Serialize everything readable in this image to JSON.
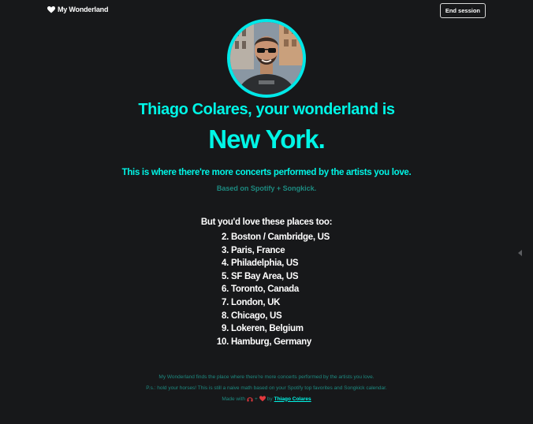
{
  "nav": {
    "brand": "My Wonderland",
    "brand_icon": "heart-icon",
    "end_session": "End session"
  },
  "profile": {
    "avatar": "user-avatar-photo"
  },
  "result": {
    "headline": "Thiago Colares, your wonderland is",
    "city": "New York.",
    "subtitle": "This is where there're more concerts performed by the artists you love.",
    "source": "Based on Spotify + Songkick."
  },
  "others": {
    "title": "But you'd love these places too:",
    "items": [
      {
        "rank": "2.",
        "place": "Boston / Cambridge, US"
      },
      {
        "rank": "3.",
        "place": "Paris, France"
      },
      {
        "rank": "4.",
        "place": "Philadelphia, US"
      },
      {
        "rank": "5.",
        "place": "SF Bay Area, US"
      },
      {
        "rank": "6.",
        "place": "Toronto, Canada"
      },
      {
        "rank": "7.",
        "place": "London, UK"
      },
      {
        "rank": "8.",
        "place": "Chicago, US"
      },
      {
        "rank": "9.",
        "place": "Lokeren, Belgium"
      },
      {
        "rank": "10.",
        "place": "Hamburg, Germany"
      }
    ]
  },
  "footer": {
    "line1": "My Wonderland finds the place where there're more concerts performed by the artists you love.",
    "line2": "P.s.: hold your horses! This is still a naive math based on your Spotify top favorites and Songkick calendar.",
    "made_with": "Made with",
    "plus": "+",
    "by": "by",
    "author": "Thiago Colares",
    "icons": [
      "headphones-icon",
      "heart-icon"
    ]
  },
  "colors": {
    "background": "#17181a",
    "accent": "#00f5e6",
    "muted_accent": "#1d8a80",
    "heart": "#e0393e"
  }
}
